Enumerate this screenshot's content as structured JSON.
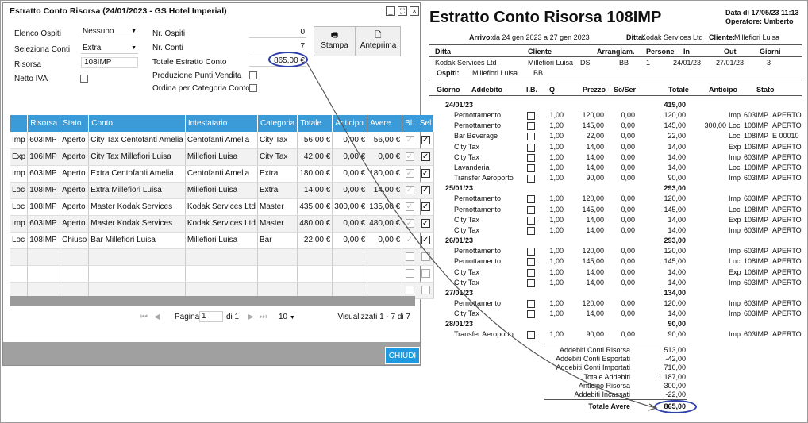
{
  "dialog": {
    "title": "Estratto Conto Risorsa (24/01/2023 - GS Hotel Imperial)",
    "labels": {
      "elenco_ospiti": "Elenco Ospiti",
      "seleziona_conti": "Seleziona Conti",
      "risorsa": "Risorsa",
      "netto_iva": "Netto IVA",
      "nr_ospiti": "Nr. Ospiti",
      "nr_conti": "Nr. Conti",
      "totale_ec": "Totale Estratto Conto",
      "prod_punti": "Produzione Punti Vendita",
      "ordina_cat": "Ordina per Categoria Conto"
    },
    "values": {
      "elenco_ospiti": "Nessuno",
      "seleziona_conti": "Extra",
      "risorsa": "108IMP",
      "nr_ospiti": "0",
      "nr_conti": "7",
      "totale_ec": "865,00 €"
    },
    "buttons": {
      "stampa": "Stampa",
      "anteprima": "Anteprima",
      "chiudi": "CHIUDI"
    },
    "grid": {
      "columns": [
        "Risorsa",
        "Stato",
        "Conto",
        "Intestatario",
        "Categoria",
        "Totale",
        "Anticipo",
        "Avere",
        "Bl.",
        "Sel"
      ],
      "rows": [
        {
          "t": "Imp",
          "r": "603IMP",
          "s": "Aperto",
          "c": "City Tax Centofanti Amelia",
          "i": "Centofanti Amelia",
          "cat": "City Tax",
          "tot": "56,00 €",
          "ant": "0,00 €",
          "av": "56,00 €"
        },
        {
          "t": "Exp",
          "r": "106IMP",
          "s": "Aperto",
          "c": "City Tax Millefiori Luisa",
          "i": "Millefiori Luisa",
          "cat": "City Tax",
          "tot": "42,00 €",
          "ant": "0,00 €",
          "av": "0,00 €"
        },
        {
          "t": "Imp",
          "r": "603IMP",
          "s": "Aperto",
          "c": "Extra Centofanti Amelia",
          "i": "Centofanti Amelia",
          "cat": "Extra",
          "tot": "180,00 €",
          "ant": "0,00 €",
          "av": "180,00 €"
        },
        {
          "t": "Loc",
          "r": "108IMP",
          "s": "Aperto",
          "c": "Extra Millefiori Luisa",
          "i": "Millefiori Luisa",
          "cat": "Extra",
          "tot": "14,00 €",
          "ant": "0,00 €",
          "av": "14,00 €"
        },
        {
          "t": "Loc",
          "r": "108IMP",
          "s": "Aperto",
          "c": "Master Kodak Services",
          "i": "Kodak Services Ltd",
          "cat": "Master",
          "tot": "435,00 €",
          "ant": "300,00 €",
          "av": "135,00 €"
        },
        {
          "t": "Imp",
          "r": "603IMP",
          "s": "Aperto",
          "c": "Master Kodak Services",
          "i": "Kodak Services Ltd",
          "cat": "Master",
          "tot": "480,00 €",
          "ant": "0,00 €",
          "av": "480,00 €"
        },
        {
          "t": "Loc",
          "r": "108IMP",
          "s": "Chiuso",
          "c": "Bar Millefiori Luisa",
          "i": "Millefiori Luisa",
          "cat": "Bar",
          "tot": "22,00 €",
          "ant": "0,00 €",
          "av": "0,00 €"
        }
      ]
    },
    "pager": {
      "label": "Pagina",
      "page": "1",
      "of": "di 1",
      "size": "10",
      "summary": "Visualizzati 1 - 7 di 7"
    }
  },
  "report": {
    "title": "Estratto Conto Risorsa 108IMP",
    "date_label": "Data di 17/05/23 11:13",
    "operator_label": "Operatore: Umberto",
    "arrivo_label": "Arrivo:",
    "arrivo": "da 24 gen 2023 a 27 gen 2023",
    "ditta_label": "Ditta:",
    "ditta": "Kodak Services Ltd",
    "cliente_label": "Cliente:",
    "cliente": "Millefiori Luisa",
    "head1": [
      "Ditta",
      "Cliente",
      "Arrangiam.",
      "Persone",
      "In",
      "Out",
      "Giorni"
    ],
    "row1": [
      "Kodak Services Ltd",
      "Millefiori Luisa",
      "DS",
      "BB",
      "1",
      "24/01/23",
      "27/01/23",
      "3"
    ],
    "ospiti_label": "Ospiti:",
    "ospiti": "Millefiori Luisa",
    "ospiti_arr": "BB",
    "head2": [
      "Giorno",
      "Addebito",
      "I.B.",
      "Q",
      "Prezzo",
      "Sc/Ser",
      "Totale",
      "Anticipo",
      "Stato"
    ],
    "days": [
      {
        "d": "24/01/23",
        "tot": "419,00",
        "items": [
          [
            "Pernottamento",
            "1,00",
            "120,00",
            "0,00",
            "120,00",
            "",
            "Imp",
            "603IMP",
            "APERTO"
          ],
          [
            "Pernottamento",
            "1,00",
            "145,00",
            "0,00",
            "145,00",
            "300,00",
            "Loc",
            "108IMP",
            "APERTO"
          ],
          [
            "Bar Beverage",
            "1,00",
            "22,00",
            "0,00",
            "22,00",
            "",
            "Loc",
            "108IMP",
            "E 00010"
          ],
          [
            "City Tax",
            "1,00",
            "14,00",
            "0,00",
            "14,00",
            "",
            "Exp",
            "106IMP",
            "APERTO"
          ],
          [
            "City Tax",
            "1,00",
            "14,00",
            "0,00",
            "14,00",
            "",
            "Imp",
            "603IMP",
            "APERTO"
          ],
          [
            "Lavanderia",
            "1,00",
            "14,00",
            "0,00",
            "14,00",
            "",
            "Loc",
            "108IMP",
            "APERTO"
          ],
          [
            "Transfer Aeroporto",
            "1,00",
            "90,00",
            "0,00",
            "90,00",
            "",
            "Imp",
            "603IMP",
            "APERTO"
          ]
        ]
      },
      {
        "d": "25/01/23",
        "tot": "293,00",
        "items": [
          [
            "Pernottamento",
            "1,00",
            "120,00",
            "0,00",
            "120,00",
            "",
            "Imp",
            "603IMP",
            "APERTO"
          ],
          [
            "Pernottamento",
            "1,00",
            "145,00",
            "0,00",
            "145,00",
            "",
            "Loc",
            "108IMP",
            "APERTO"
          ],
          [
            "City Tax",
            "1,00",
            "14,00",
            "0,00",
            "14,00",
            "",
            "Exp",
            "106IMP",
            "APERTO"
          ],
          [
            "City Tax",
            "1,00",
            "14,00",
            "0,00",
            "14,00",
            "",
            "Imp",
            "603IMP",
            "APERTO"
          ]
        ]
      },
      {
        "d": "26/01/23",
        "tot": "293,00",
        "items": [
          [
            "Pernottamento",
            "1,00",
            "120,00",
            "0,00",
            "120,00",
            "",
            "Imp",
            "603IMP",
            "APERTO"
          ],
          [
            "Pernottamento",
            "1,00",
            "145,00",
            "0,00",
            "145,00",
            "",
            "Loc",
            "108IMP",
            "APERTO"
          ],
          [
            "City Tax",
            "1,00",
            "14,00",
            "0,00",
            "14,00",
            "",
            "Exp",
            "106IMP",
            "APERTO"
          ],
          [
            "City Tax",
            "1,00",
            "14,00",
            "0,00",
            "14,00",
            "",
            "Imp",
            "603IMP",
            "APERTO"
          ]
        ]
      },
      {
        "d": "27/01/23",
        "tot": "134,00",
        "items": [
          [
            "Pernottamento",
            "1,00",
            "120,00",
            "0,00",
            "120,00",
            "",
            "Imp",
            "603IMP",
            "APERTO"
          ],
          [
            "City Tax",
            "1,00",
            "14,00",
            "0,00",
            "14,00",
            "",
            "Imp",
            "603IMP",
            "APERTO"
          ]
        ]
      },
      {
        "d": "28/01/23",
        "tot": "90,00",
        "items": [
          [
            "Transfer Aeroporto",
            "1,00",
            "90,00",
            "0,00",
            "90,00",
            "",
            "Imp",
            "603IMP",
            "APERTO"
          ]
        ]
      }
    ],
    "totals": [
      [
        "Addebiti Conti Risorsa",
        "513,00"
      ],
      [
        "Addebiti Conti Esportati",
        "-42,00"
      ],
      [
        "Addebiti Conti Importati",
        "716,00"
      ],
      [
        "Totale Addebiti",
        "1.187,00"
      ],
      [
        "Anticipo Risorsa",
        "-300,00"
      ],
      [
        "Addebiti Incassati",
        "-22,00"
      ]
    ],
    "totale_avere_label": "Totale Avere",
    "totale_avere": "865,00"
  },
  "colors": {
    "header_blue": "#3b9bd9",
    "button_blue": "#1e9be0",
    "highlight": "#2d3fa8"
  }
}
